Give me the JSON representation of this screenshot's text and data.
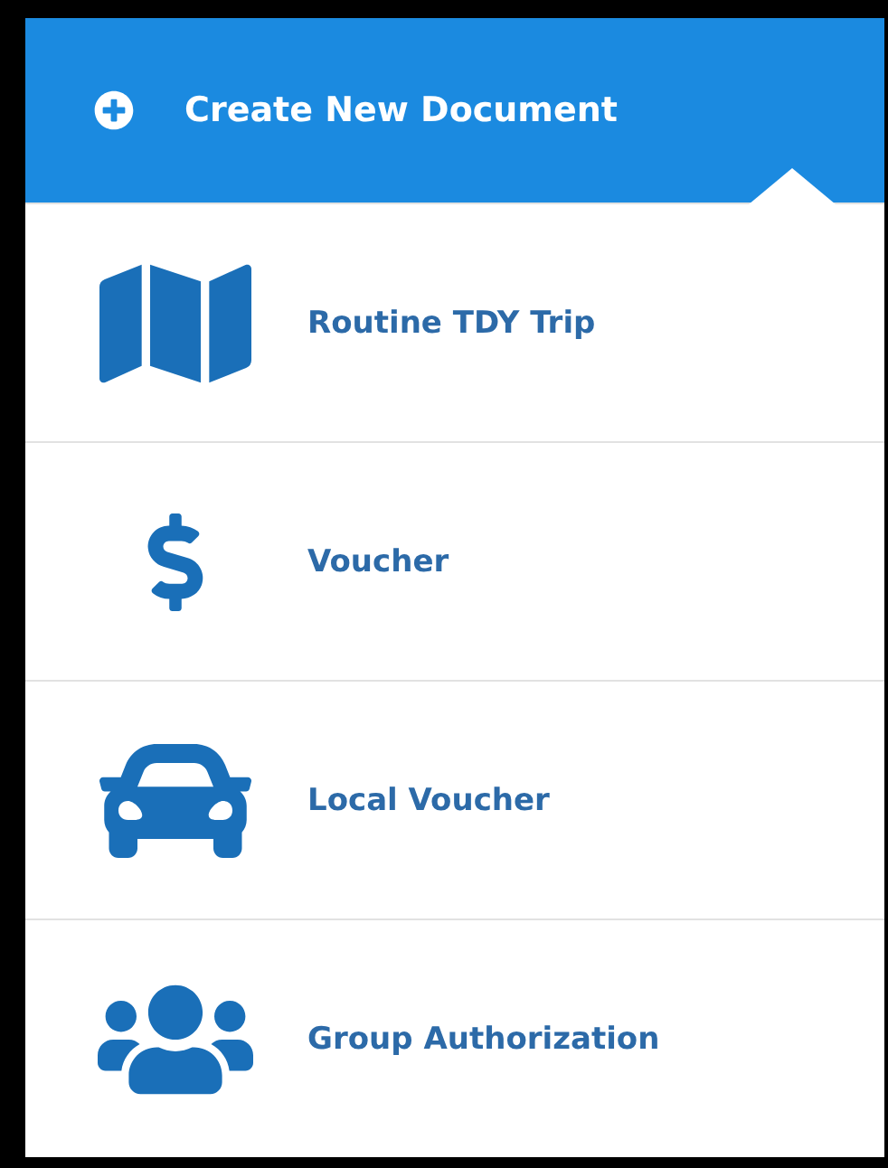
{
  "header": {
    "title": "Create New Document"
  },
  "items": [
    {
      "kind": "map",
      "label": "Routine TDY Trip"
    },
    {
      "kind": "dollar",
      "label": "Voucher"
    },
    {
      "kind": "car",
      "label": "Local Voucher"
    },
    {
      "kind": "group",
      "label": "Group Authorization"
    }
  ]
}
